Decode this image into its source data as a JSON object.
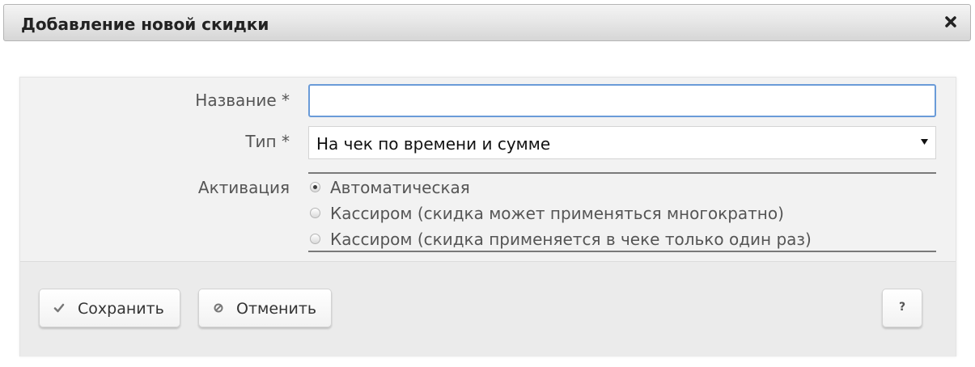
{
  "dialog": {
    "title": "Добавление новой скидки"
  },
  "form": {
    "name_label": "Название *",
    "name_value": "",
    "type_label": "Тип *",
    "type_value": "На чек по времени и сумме",
    "activation_label": "Активация",
    "activation_options": [
      {
        "label": "Автоматическая",
        "checked": true
      },
      {
        "label": "Кассиром (скидка может применяться многократно)",
        "checked": false
      },
      {
        "label": "Кассиром (скидка применяется в чеке только один раз)",
        "checked": false
      }
    ]
  },
  "buttons": {
    "save_label": "Сохранить",
    "cancel_label": "Отменить",
    "help_label": "?"
  },
  "icons": {
    "close": "close-icon",
    "select_arrow": "triangle-down-icon",
    "save": "checkmark-icon",
    "cancel": "cancel-circle-icon"
  },
  "colors": {
    "input_focus_border": "#6a9bd8",
    "panel_background": "#f2f2f2",
    "footer_background": "#ebebeb"
  }
}
